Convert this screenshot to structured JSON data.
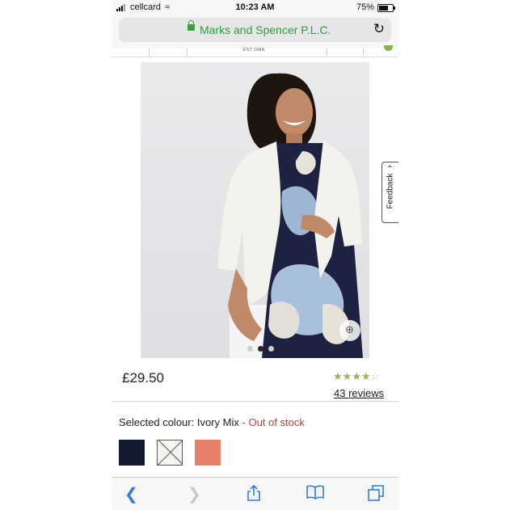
{
  "status_bar": {
    "carrier": "cellcard",
    "time": "10:23 AM",
    "battery": "75%"
  },
  "address_bar": {
    "site_title": "Marks and Spencer P.L.C."
  },
  "site_header": {
    "est": "EST 1884"
  },
  "product": {
    "price": "£29.50",
    "rating": 4,
    "rating_max": 5,
    "review_count": "43",
    "review_label": "reviews",
    "image_index": 1,
    "image_count": 3
  },
  "feedback_tab": {
    "label": "Feedback"
  },
  "colour": {
    "label": "Selected colour:",
    "selected": "Ivory Mix",
    "separator": "-",
    "stock_status": "Out of stock",
    "swatches": [
      {
        "name": "Navy",
        "color": "#111a2e"
      },
      {
        "name": "Ivory Mix",
        "color": "#f7f6f1",
        "unavailable": true
      },
      {
        "name": "Coral",
        "color": "#e87f6a"
      }
    ]
  },
  "icons": {
    "back": "chevron-left-icon",
    "forward": "chevron-right-icon",
    "share": "share-icon",
    "bookmarks": "book-icon",
    "tabs": "tabs-icon"
  }
}
